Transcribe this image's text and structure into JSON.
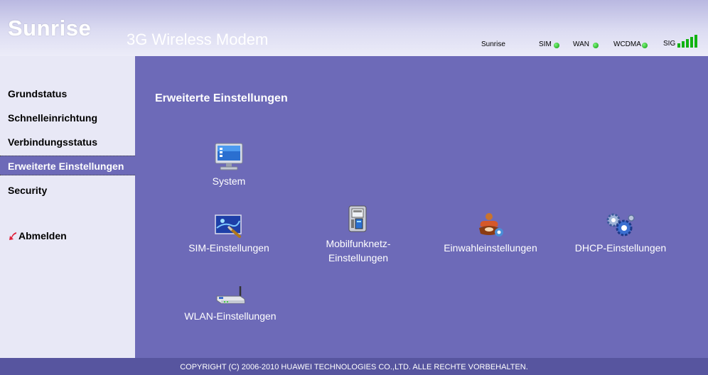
{
  "header": {
    "logo": "Sunrise",
    "product": "3G Wireless Modem",
    "status": {
      "operator": "Sunrise",
      "sim": "SIM",
      "wan": "WAN",
      "network": "WCDMA",
      "signal_label": "SIG",
      "signal_bars": 5,
      "led_color": "#19c419"
    }
  },
  "sidebar": {
    "items": [
      {
        "label": "Grundstatus"
      },
      {
        "label": "Schnelleinrichtung"
      },
      {
        "label": "Verbindungsstatus"
      },
      {
        "label": "Erweiterte Einstellungen"
      },
      {
        "label": "Security"
      }
    ],
    "active_index": 3,
    "logout": "Abmelden"
  },
  "main": {
    "title": "Erweiterte Einstellungen",
    "tiles": {
      "system": {
        "label": "System",
        "icon": "monitor-icon"
      },
      "sim": {
        "label": "SIM-Einstellungen",
        "icon": "sim-settings-icon"
      },
      "mobile": {
        "label_line1": "Mobilfunknetz-",
        "label_line2": "Einstellungen",
        "icon": "mobile-phone-icon"
      },
      "dialup": {
        "label": "Einwahleinstellungen",
        "icon": "dialup-icon"
      },
      "dhcp": {
        "label": "DHCP-Einstellungen",
        "icon": "gears-icon"
      },
      "wlan": {
        "label": "WLAN-Einstellungen",
        "icon": "router-icon"
      }
    }
  },
  "footer": {
    "copyright": "COPYRIGHT (C) 2006-2010 HUAWEI TECHNOLOGIES CO.,LTD. ALLE RECHTE VORBEHALTEN."
  },
  "colors": {
    "main_bg": "#6d6ab8",
    "sidebar_bg": "#e8e8f6",
    "footer_bg": "#57559f"
  }
}
